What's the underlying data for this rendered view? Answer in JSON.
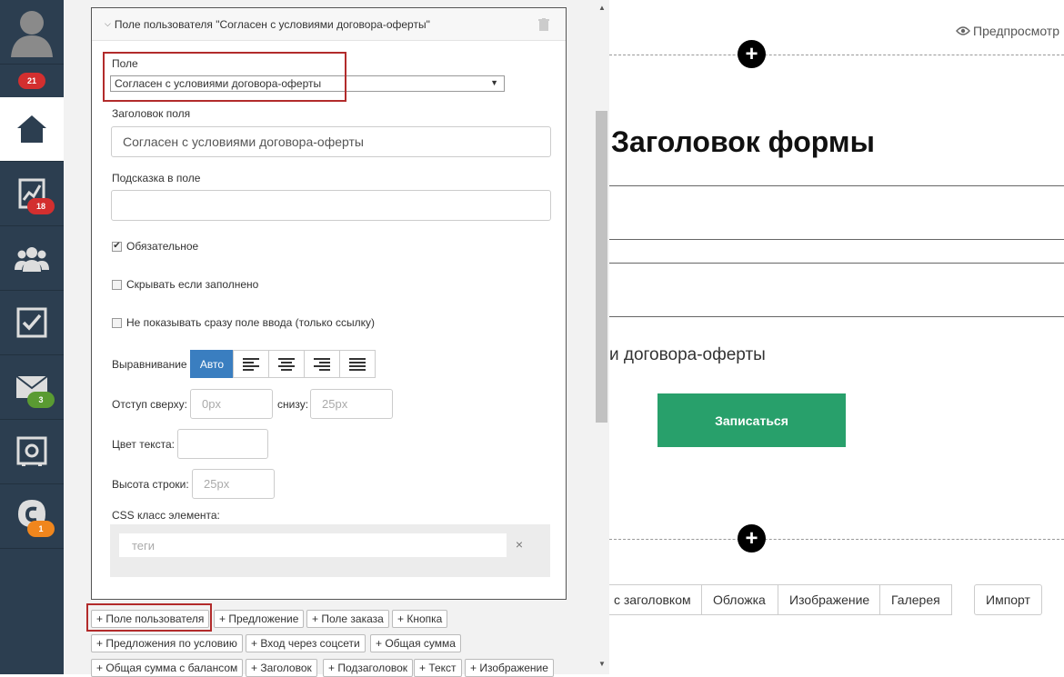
{
  "sidebar": {
    "badges": {
      "profile": "21",
      "stats": "18",
      "mail": "3",
      "support": "1"
    }
  },
  "panel": {
    "header_title": "Поле пользователя \"Согласен с условиями договора-оферты\"",
    "field_label": "Поле",
    "field_value": "Согласен с условиями договора-оферты",
    "title_label": "Заголовок поля",
    "title_value": "Согласен с условиями договора-оферты",
    "hint_label": "Подсказка в поле",
    "hint_value": "",
    "required_label": "Обязательное",
    "required_checked": true,
    "hide_filled_label": "Скрывать если заполнено",
    "no_input_label": "Не показывать сразу поле ввода (только ссылку)",
    "align_label": "Выравнивание",
    "align_auto": "Авто",
    "padding_top_label": "Отступ сверху:",
    "padding_top_placeholder": "0px",
    "padding_bottom_label": "снизу:",
    "padding_bottom_placeholder": "25px",
    "text_color_label": "Цвет текста:",
    "line_height_label": "Высота строки:",
    "line_height_placeholder": "25px",
    "css_label": "CSS класс элемента:",
    "tags_placeholder": "теги",
    "tags_clear": "×"
  },
  "add_buttons": [
    "+ Поле пользователя",
    "+ Предложение",
    "+ Поле заказа",
    "+ Кнопка",
    "+ Предложения по условию",
    "+ Вход через соцсети",
    "+ Общая сумма",
    "+ Общая сумма с балансом",
    "+ Заголовок",
    "+ Подзаголовок",
    "+ Текст",
    "+ Изображение"
  ],
  "preview": {
    "preview_link": "Предпросмотр",
    "form_title": "Заголовок формы",
    "consent_text": "и договора-оферты",
    "submit_label": "Записаться",
    "block_buttons": [
      "с заголовком",
      "Обложка",
      "Изображение",
      "Галерея"
    ],
    "import_label": "Импорт"
  },
  "colors": {
    "accent_blue": "#3a7ec0",
    "submit_green": "#28a06b",
    "highlight_red": "#b22b2b",
    "sidebar": "#2c3e50"
  }
}
